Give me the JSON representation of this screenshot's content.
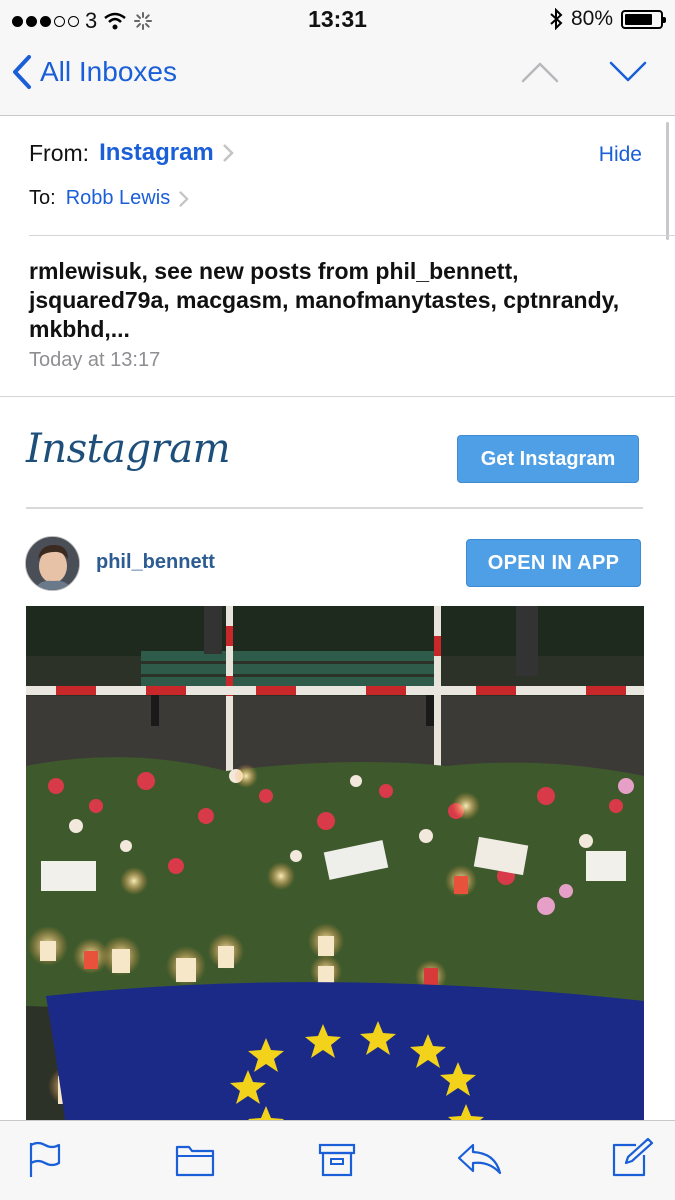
{
  "status_bar": {
    "carrier": "3",
    "time": "13:31",
    "battery_percent": "80%",
    "battery_level": 0.8,
    "signal_bars_filled": 3,
    "signal_bars_total": 5
  },
  "nav": {
    "back_label": "All Inboxes",
    "accent_color": "#1a5fd8"
  },
  "header": {
    "from_label": "From:",
    "from_name": "Instagram",
    "hide_label": "Hide",
    "to_label": "To:",
    "to_name": "Robb Lewis",
    "subject": "rmlewisuk, see new posts from phil_bennett, jsquared79a, macgasm, manofmanytastes, cptnrandy, mkbhd,...",
    "date": "Today at 13:17"
  },
  "email_body": {
    "logo_text": "Instagram",
    "get_button": "Get Instagram",
    "post": {
      "username": "phil_bennett",
      "open_button": "OPEN IN APP"
    },
    "button_color": "#4f9fe6"
  },
  "toolbar": {
    "icons": [
      "flag-icon",
      "folder-icon",
      "archive-icon",
      "reply-icon",
      "compose-icon"
    ]
  }
}
